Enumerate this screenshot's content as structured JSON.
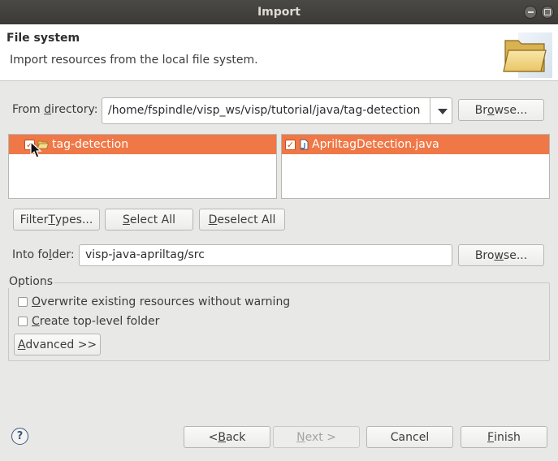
{
  "window": {
    "title": "Import"
  },
  "header": {
    "title": "File system",
    "description": "Import resources from the local file system."
  },
  "from_directory": {
    "label_pre": "From ",
    "label_u": "d",
    "label_post": "irectory:",
    "value": "/home/fspindle/visp_ws/visp/tutorial/java/tag-detection",
    "browse_pre": "Br",
    "browse_u": "o",
    "browse_post": "wse..."
  },
  "left_tree": {
    "item": {
      "label": "tag-detection",
      "checked": true,
      "icon": "folder-open-icon"
    }
  },
  "right_list": {
    "item": {
      "label": "ApriltagDetection.java",
      "checked": true,
      "icon": "java-file-icon"
    }
  },
  "buttons": {
    "filter_pre": "Filter ",
    "filter_u": "T",
    "filter_post": "ypes...",
    "select_pre": "",
    "select_u": "S",
    "select_post": "elect All",
    "deselect_pre": "",
    "deselect_u": "D",
    "deselect_post": "eselect All"
  },
  "into_folder": {
    "label_pre": "Into fo",
    "label_u": "l",
    "label_post": "der:",
    "value": "visp-java-apriltag/src",
    "browse_pre": "Bro",
    "browse_u": "w",
    "browse_post": "se..."
  },
  "options": {
    "group_label": "Options",
    "overwrite_pre": "",
    "overwrite_u": "O",
    "overwrite_post": "verwrite existing resources without warning",
    "overwrite_checked": false,
    "create_pre": "",
    "create_u": "C",
    "create_post": "reate top-level folder",
    "create_checked": false,
    "advanced_pre": "",
    "advanced_u": "A",
    "advanced_post": "dvanced >>"
  },
  "footer": {
    "help": "?",
    "back_pre": "< ",
    "back_u": "B",
    "back_post": "ack",
    "next_pre": "",
    "next_u": "N",
    "next_post": "ext >",
    "cancel": "Cancel",
    "finish_pre": "",
    "finish_u": "F",
    "finish_post": "inish"
  },
  "colors": {
    "selection": "#f07746",
    "titlebar": "#3b3a37"
  }
}
